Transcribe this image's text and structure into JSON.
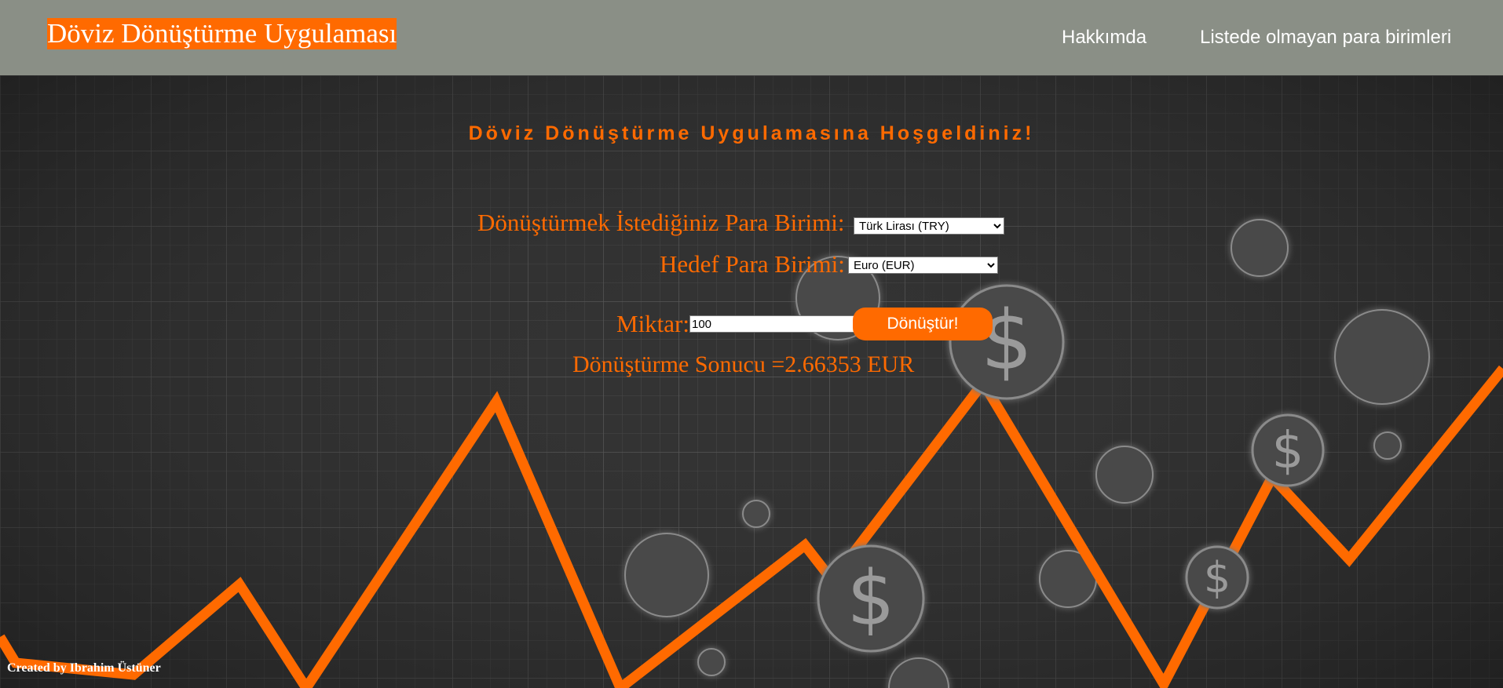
{
  "navbar": {
    "brand": "Döviz Dönüştürme Uygulaması",
    "links": [
      "Hakkımda",
      "Listede olmayan para birimleri"
    ]
  },
  "main": {
    "welcome": "Döviz Dönüştürme Uygulamasına Hoşgeldiniz!",
    "source_label": "Dönüştürmek İstediğiniz Para Birimi:",
    "source_selected": "Türk Lirası (TRY)",
    "target_label": "Hedef Para Birimi:",
    "target_selected": "Euro (EUR)",
    "amount_label": "Miktar:",
    "amount_value": "100",
    "convert_label": "Dönüştür!",
    "result_text": "Dönüştürme Sonucu =2.66353 EUR"
  },
  "footer": {
    "credit": "Created by Ibrahim Üstüner"
  },
  "colors": {
    "accent": "#ff6a00",
    "navbar": "#8a8f86",
    "background": "#2e2e2e"
  },
  "icons": [
    "dollar-coin-icon"
  ]
}
